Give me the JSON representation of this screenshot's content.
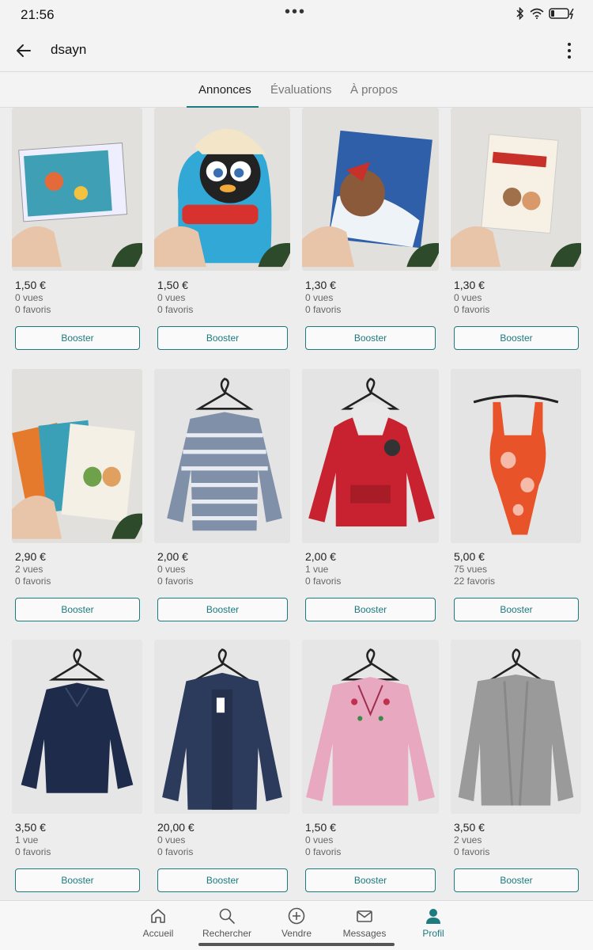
{
  "status_bar": {
    "time": "21:56"
  },
  "header": {
    "title": "dsayn"
  },
  "tabs": [
    {
      "label": "Annonces",
      "active": true
    },
    {
      "label": "Évaluations",
      "active": false
    },
    {
      "label": "À propos",
      "active": false
    }
  ],
  "listings": [
    {
      "price": "1,50 €",
      "views": "0 vues",
      "favorites": "0 favoris",
      "button": "Booster",
      "image": "puzzle-box"
    },
    {
      "price": "1,50 €",
      "views": "0 vues",
      "favorites": "0 favoris",
      "button": "Booster",
      "image": "calimero-book"
    },
    {
      "price": "1,30 €",
      "views": "0 vues",
      "favorites": "0 favoris",
      "button": "Booster",
      "image": "book-noel-herisson"
    },
    {
      "price": "1,30 €",
      "views": "0 vues",
      "favorites": "0 favoris",
      "button": "Booster",
      "image": "book-vrai-heros-jo"
    },
    {
      "price": "2,90 €",
      "views": "2 vues",
      "favorites": "0 favoris",
      "button": "Booster",
      "image": "books-stack"
    },
    {
      "price": "2,00 €",
      "views": "0 vues",
      "favorites": "0 favoris",
      "button": "Booster",
      "image": "striped-sweater"
    },
    {
      "price": "2,00 €",
      "views": "1 vue",
      "favorites": "0 favoris",
      "button": "Booster",
      "image": "red-hoodie"
    },
    {
      "price": "5,00 €",
      "views": "75 vues",
      "favorites": "22 favoris",
      "button": "Booster",
      "image": "orange-swimsuit"
    },
    {
      "price": "3,50 €",
      "views": "1 vue",
      "favorites": "0 favoris",
      "button": "Booster",
      "image": "navy-sweater"
    },
    {
      "price": "20,00 €",
      "views": "0 vues",
      "favorites": "0 favoris",
      "button": "Booster",
      "image": "navy-cardigan"
    },
    {
      "price": "1,50 €",
      "views": "0 vues",
      "favorites": "0 favoris",
      "button": "Booster",
      "image": "pink-sweater"
    },
    {
      "price": "3,50 €",
      "views": "2 vues",
      "favorites": "0 favoris",
      "button": "Booster",
      "image": "grey-cardigan"
    }
  ],
  "bottom_nav": [
    {
      "label": "Accueil",
      "icon": "home-icon",
      "active": false
    },
    {
      "label": "Rechercher",
      "icon": "search-icon",
      "active": false
    },
    {
      "label": "Vendre",
      "icon": "plus-circle-icon",
      "active": false
    },
    {
      "label": "Messages",
      "icon": "envelope-icon",
      "active": false
    },
    {
      "label": "Profil",
      "icon": "profile-icon",
      "active": true
    }
  ],
  "colors": {
    "accent": "#1d7a7e",
    "background": "#ededed"
  }
}
